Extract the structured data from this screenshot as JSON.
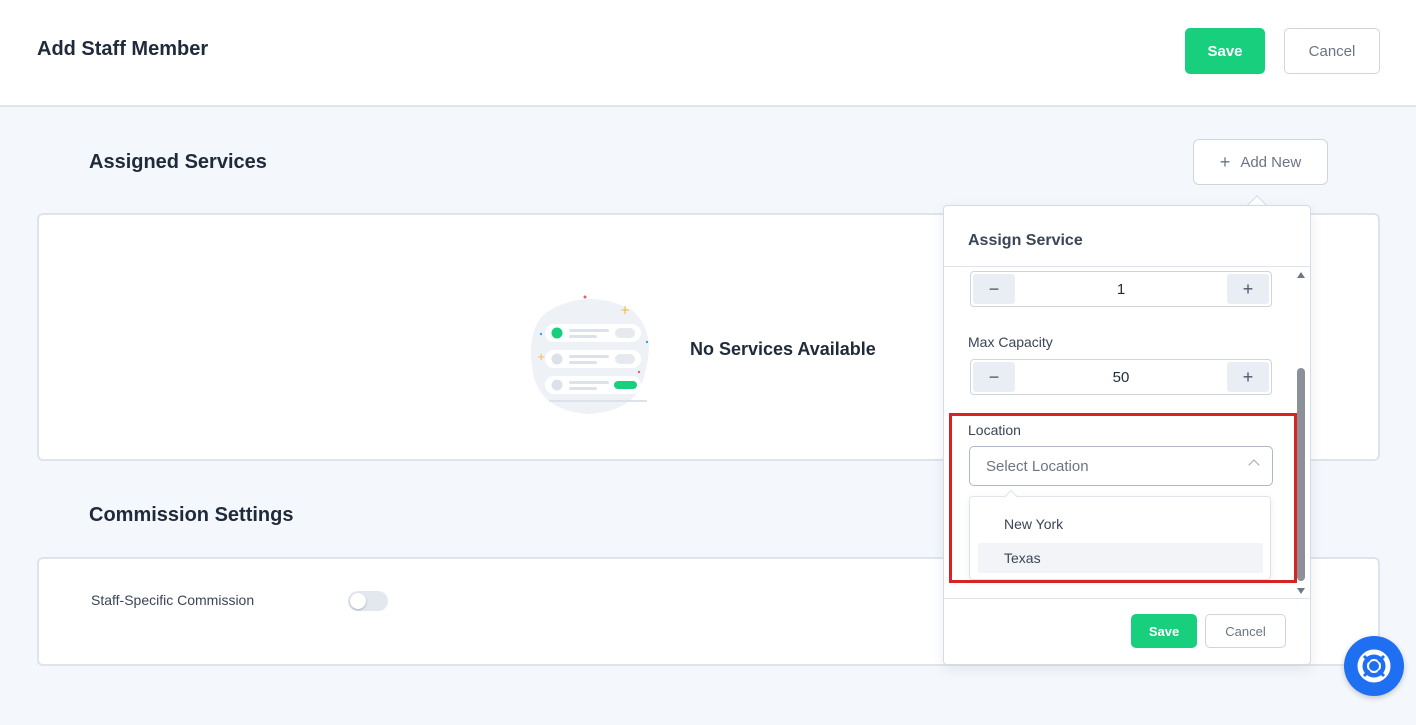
{
  "header": {
    "title": "Add Staff Member",
    "save_label": "Save",
    "cancel_label": "Cancel"
  },
  "assigned_services": {
    "title": "Assigned Services",
    "add_new_label": "Add New",
    "empty_text": "No Services Available"
  },
  "commission": {
    "title": "Commission Settings",
    "staff_specific_label": "Staff-Specific Commission",
    "toggle_on": false
  },
  "assign_service": {
    "title": "Assign Service",
    "first_stepper_value": "1",
    "max_capacity_label": "Max Capacity",
    "max_capacity_value": "50",
    "location_label": "Location",
    "location_placeholder": "Select Location",
    "location_options": [
      "New York",
      "Texas"
    ],
    "save_label": "Save",
    "cancel_label": "Cancel"
  },
  "colors": {
    "primary": "#17cf7c",
    "highlight": "#d62424",
    "help": "#1f6ff2"
  },
  "icons": {
    "add": "plus-icon",
    "decrement": "minus-icon",
    "increment": "plus-icon",
    "dropdown": "chevron-up-icon",
    "help": "lifebuoy-icon"
  }
}
